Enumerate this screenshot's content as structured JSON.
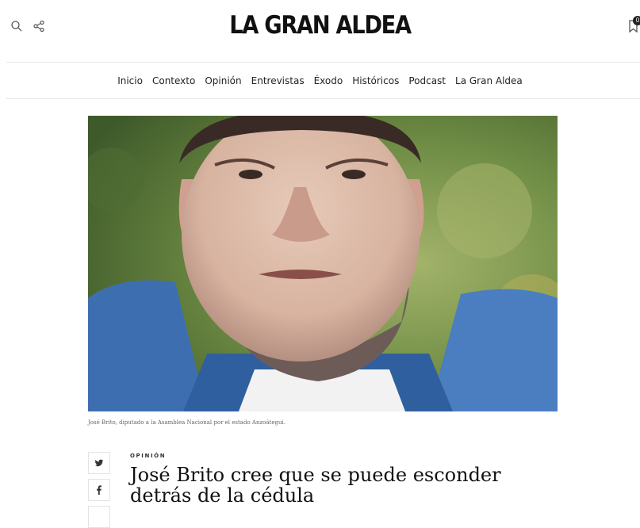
{
  "site": {
    "logo": "LA GRAN ALDEA"
  },
  "header": {
    "icons": [
      "search-icon",
      "share-icon",
      "bookmark-icon"
    ],
    "bookmark_count": "0"
  },
  "nav": {
    "items": [
      "Inicio",
      "Contexto",
      "Opinión",
      "Entrevistas",
      "Éxodo",
      "Históricos",
      "Podcast",
      "La Gran Aldea"
    ]
  },
  "article": {
    "image_caption": "José Brito, diputado a la Asamblea Nacional por el estado Anzoátegui.",
    "category": "OPINIÓN",
    "title_line1": "José Brito cree que se puede esconder",
    "title_line2": "detrás de la cédula"
  },
  "share": {
    "icons": [
      "twitter-icon",
      "facebook-icon"
    ]
  },
  "colors": {
    "text": "#222222",
    "divider": "#e6e6e6",
    "background": "#ffffff"
  }
}
